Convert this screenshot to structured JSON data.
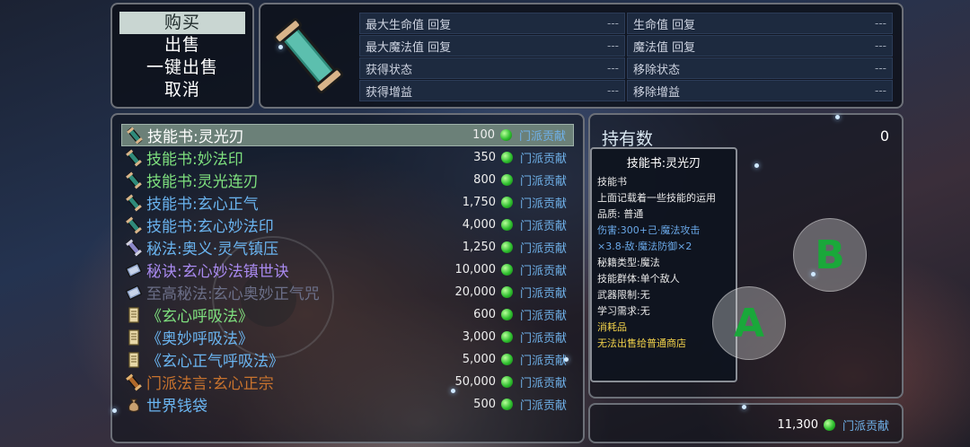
{
  "menu": {
    "items": [
      {
        "label": "购买"
      },
      {
        "label": "出售"
      },
      {
        "label": "一键出售"
      },
      {
        "label": "取消"
      }
    ]
  },
  "stats": {
    "rows": [
      [
        {
          "label": "最大生命值 回复",
          "value": "---"
        },
        {
          "label": "生命值 回复",
          "value": "---"
        }
      ],
      [
        {
          "label": "最大魔法值 回复",
          "value": "---"
        },
        {
          "label": "魔法值 回复",
          "value": "---"
        }
      ],
      [
        {
          "label": "获得状态",
          "value": "---"
        },
        {
          "label": "移除状态",
          "value": "---"
        }
      ],
      [
        {
          "label": "获得增益",
          "value": "---"
        },
        {
          "label": "移除增益",
          "value": "---"
        }
      ]
    ]
  },
  "shop": {
    "items": [
      {
        "name": "技能书:灵光刃",
        "price": "100",
        "currency": "门派贡献",
        "color": "#ffffff",
        "icon": "skill-book-icon"
      },
      {
        "name": "技能书:妙法印",
        "price": "350",
        "currency": "门派贡献",
        "color": "#7ee07e",
        "icon": "skill-book-icon"
      },
      {
        "name": "技能书:灵光连刃",
        "price": "800",
        "currency": "门派贡献",
        "color": "#7ee07e",
        "icon": "skill-book-icon"
      },
      {
        "name": "技能书:玄心正气",
        "price": "1,750",
        "currency": "门派贡献",
        "color": "#6ab4f0",
        "icon": "skill-book-icon"
      },
      {
        "name": "技能书:玄心妙法印",
        "price": "4,000",
        "currency": "门派贡献",
        "color": "#6ab4f0",
        "icon": "skill-book-icon"
      },
      {
        "name": "秘法:奥义·灵气镇压",
        "price": "1,250",
        "currency": "门派贡献",
        "color": "#6ab4f0",
        "icon": "secret-scroll-icon"
      },
      {
        "name": "秘诀:玄心妙法镇世诀",
        "price": "10,000",
        "currency": "门派贡献",
        "color": "#a98af0",
        "icon": "secret-book-icon"
      },
      {
        "name": "至高秘法:玄心奥妙正气咒",
        "price": "20,000",
        "currency": "门派贡献",
        "color": "#6b6f88",
        "icon": "secret-book-icon"
      },
      {
        "name": "《玄心呼吸法》",
        "price": "600",
        "currency": "门派贡献",
        "color": "#7ee07e",
        "icon": "manual-icon"
      },
      {
        "name": "《奥妙呼吸法》",
        "price": "3,000",
        "currency": "门派贡献",
        "color": "#6ab4f0",
        "icon": "manual-icon"
      },
      {
        "name": "《玄心正气呼吸法》",
        "price": "5,000",
        "currency": "门派贡献",
        "color": "#6ab4f0",
        "icon": "manual-icon"
      },
      {
        "name": "门派法言:玄心正宗",
        "price": "50,000",
        "currency": "门派贡献",
        "color": "#c8732e",
        "icon": "sect-scroll-icon"
      },
      {
        "name": "世界钱袋",
        "price": "500",
        "currency": "门派贡献",
        "color": "#6ab4f0",
        "icon": "money-bag-icon"
      }
    ]
  },
  "detail": {
    "owned_label": "持有数",
    "owned_value": "0"
  },
  "tooltip": {
    "title": "技能书:灵光刃",
    "category": "技能书",
    "description": "上面记载着一些技能的运用",
    "quality": "品质: 普通",
    "damage_line1": "伤害:300+己·魔法攻击",
    "damage_line2": "×3.8-敌·魔法防御×2",
    "secret_type": "秘籍类型:魔法",
    "target_group": "技能群体:单个敌人",
    "weapon_limit": "武器限制:无",
    "learn_req": "学习需求:无",
    "consumable": "消耗品",
    "sell_note": "无法出售给普通商店"
  },
  "wallet": {
    "amount": "11,300",
    "currency": "门派贡献"
  },
  "controls": {
    "a_label": "A",
    "b_label": "B"
  },
  "colors": {
    "accent_currency": "#6fb0e8",
    "gem": "#2fbf2f",
    "selection": "#6b8078"
  }
}
